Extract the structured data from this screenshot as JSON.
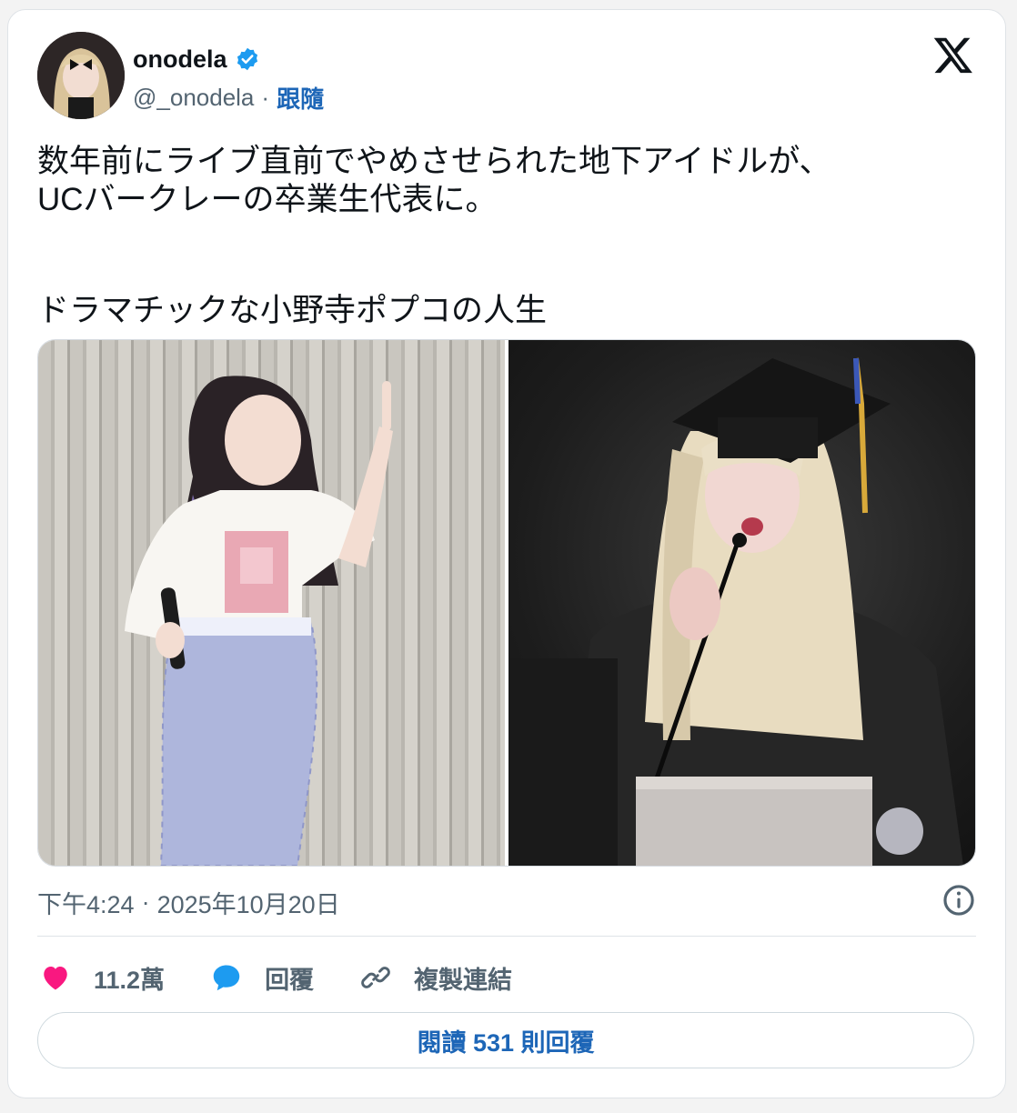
{
  "author": {
    "name": "onodela",
    "handle": "@_onodela",
    "separator": "·",
    "follow_label": "跟隨"
  },
  "tweet": {
    "line1": "数年前にライブ直前でやめさせられた地下アイドルが、",
    "line2": "UCバークレーの卒業生代表に。",
    "line3": "ドラマチックな小野寺ポプコの人生"
  },
  "media": {
    "photos": [
      "idol-on-stage-photo",
      "graduation-speech-photo"
    ]
  },
  "meta": {
    "time": "下午4:24",
    "separator": "·",
    "date": "2025年10月20日"
  },
  "actions": {
    "likes": "11.2萬",
    "reply_label": "回覆",
    "copy_link_label": "複製連結"
  },
  "read_replies_label": "閱讀 531 則回覆",
  "colors": {
    "link_blue": "#1d66b7",
    "like_pink": "#f91880",
    "reply_blue": "#1d9bf0",
    "secondary_text": "#536471"
  }
}
